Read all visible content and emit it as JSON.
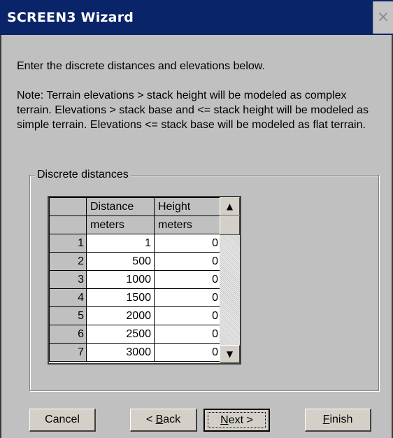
{
  "window": {
    "title": "SCREEN3 Wizard",
    "close_glyph": "×"
  },
  "intro_text": "Enter the discrete distances and elevations below.",
  "note_text": "Note:  Terrain elevations > stack height will be modeled as complex terrain.  Elevations > stack base and <= stack height will be modeled as simple terrain.  Elevations <= stack base will be modeled as flat terrain.",
  "group_label": "Discrete distances",
  "grid": {
    "columns": [
      "Distance",
      "Height"
    ],
    "units": [
      "meters",
      "meters"
    ],
    "rows": [
      {
        "n": "1",
        "distance": "1",
        "height": "0"
      },
      {
        "n": "2",
        "distance": "500",
        "height": "0"
      },
      {
        "n": "3",
        "distance": "1000",
        "height": "0"
      },
      {
        "n": "4",
        "distance": "1500",
        "height": "0"
      },
      {
        "n": "5",
        "distance": "2000",
        "height": "0"
      },
      {
        "n": "6",
        "distance": "2500",
        "height": "0"
      },
      {
        "n": "7",
        "distance": "3000",
        "height": "0"
      }
    ]
  },
  "buttons": {
    "cancel": "Cancel",
    "back_prefix": "< ",
    "back_ul": "B",
    "back_rest": "ack",
    "next_ul": "N",
    "next_rest": "ext >",
    "finish_ul": "F",
    "finish_rest": "inish"
  },
  "icons": {
    "close": "close-icon",
    "scroll_up": "arrow-up-icon",
    "scroll_down": "arrow-down-icon"
  }
}
